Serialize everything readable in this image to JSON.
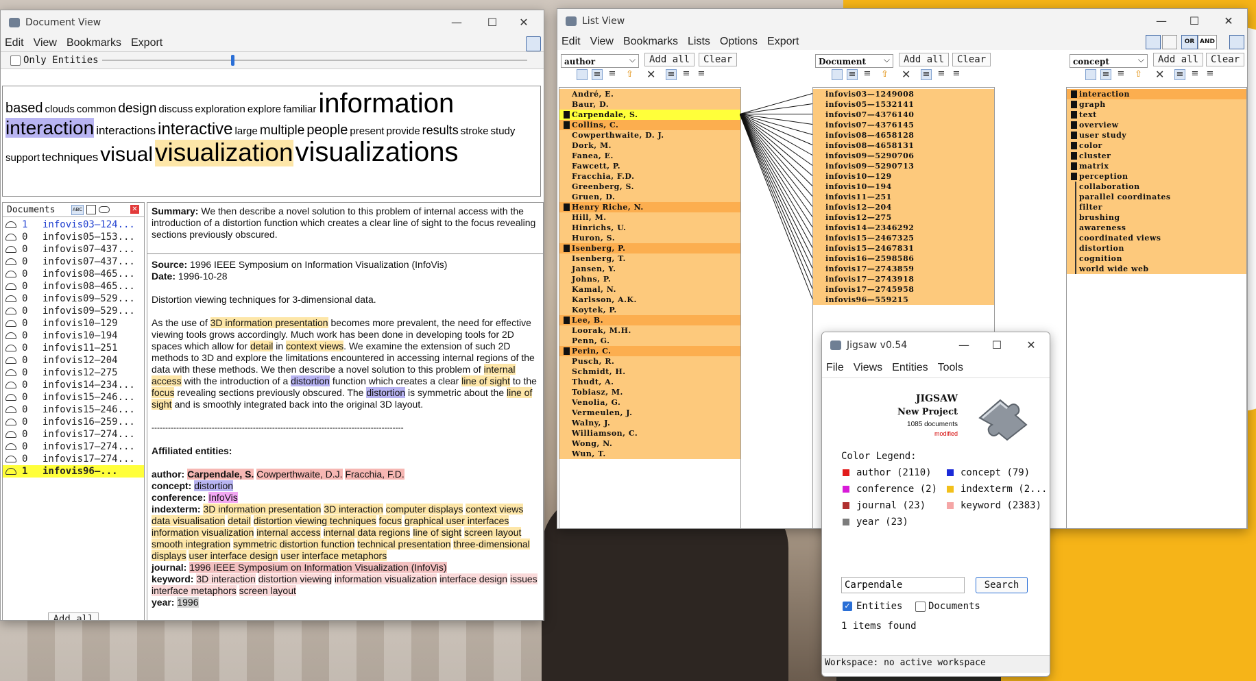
{
  "doc_view": {
    "title": "Document View",
    "menu": [
      "Edit",
      "View",
      "Bookmarks",
      "Export"
    ],
    "only_entities_label": "Only Entities",
    "cloud": [
      {
        "w": "based",
        "s": 20
      },
      {
        "w": "clouds",
        "s": 15
      },
      {
        "w": "common",
        "s": 15
      },
      {
        "w": "design",
        "s": 19
      },
      {
        "w": "discuss",
        "s": 15
      },
      {
        "w": "exploration",
        "s": 15
      },
      {
        "w": "explore",
        "s": 15
      },
      {
        "w": "familiar",
        "s": 15
      },
      {
        "w": "information",
        "s": 40
      },
      {
        "w": "interaction",
        "s": 28,
        "hl": "blue"
      },
      {
        "w": "interactions",
        "s": 17
      },
      {
        "w": "interactive",
        "s": 24
      },
      {
        "w": "large",
        "s": 15
      },
      {
        "w": "multiple",
        "s": 19
      },
      {
        "w": "people",
        "s": 20
      },
      {
        "w": "present",
        "s": 15
      },
      {
        "w": "provide",
        "s": 15
      },
      {
        "w": "results",
        "s": 18
      },
      {
        "w": "stroke",
        "s": 15
      },
      {
        "w": "study",
        "s": 15
      },
      {
        "w": "support",
        "s": 15
      },
      {
        "w": "techniques",
        "s": 17
      },
      {
        "w": "visual",
        "s": 30
      },
      {
        "w": "visualization",
        "s": 37,
        "hl": "yellow"
      },
      {
        "w": "visualizations",
        "s": 40
      }
    ],
    "documents_label": "Documents",
    "add_all": "Add all",
    "documents": [
      {
        "n": "1",
        "id": "infovis03—124...",
        "link": true
      },
      {
        "n": "0",
        "id": "infovis05—153..."
      },
      {
        "n": "0",
        "id": "infovis07—437..."
      },
      {
        "n": "0",
        "id": "infovis07—437..."
      },
      {
        "n": "0",
        "id": "infovis08—465..."
      },
      {
        "n": "0",
        "id": "infovis08—465..."
      },
      {
        "n": "0",
        "id": "infovis09—529..."
      },
      {
        "n": "0",
        "id": "infovis09—529..."
      },
      {
        "n": "0",
        "id": "infovis10—129"
      },
      {
        "n": "0",
        "id": "infovis10—194"
      },
      {
        "n": "0",
        "id": "infovis11—251"
      },
      {
        "n": "0",
        "id": "infovis12—204"
      },
      {
        "n": "0",
        "id": "infovis12—275"
      },
      {
        "n": "0",
        "id": "infovis14—234..."
      },
      {
        "n": "0",
        "id": "infovis15—246..."
      },
      {
        "n": "0",
        "id": "infovis15—246..."
      },
      {
        "n": "0",
        "id": "infovis16—259..."
      },
      {
        "n": "0",
        "id": "infovis17—274..."
      },
      {
        "n": "0",
        "id": "infovis17—274..."
      },
      {
        "n": "0",
        "id": "infovis17—274..."
      },
      {
        "n": "1",
        "id": "infovis96—...",
        "sel": true
      }
    ],
    "summary_label": "Summary:",
    "summary_text": "We then describe a novel solution to this problem of internal access with the introduction of a distortion function which creates a clear line of sight to the focus revealing sections previously obscured.",
    "source_label": "Source:",
    "source_text": "1996 IEEE Symposium on Information Visualization (InfoVis)",
    "date_label": "Date:",
    "date_text": "1996-10-28",
    "doc_title": "Distortion viewing techniques for 3-dimensional data.",
    "divider": "--------------------------------------------------------------------------------------------",
    "affiliated_label": "Affiliated entities:",
    "author_label": "author:",
    "authors": [
      "Carpendale, S.",
      "Cowperthwaite, D.J.",
      "Fracchia, F.D."
    ],
    "concept_label": "concept:",
    "concept": "distortion",
    "conference_label": "conference:",
    "conference": "InfoVis",
    "indexterm_label": "indexterm:",
    "indexterms": [
      "3D information presentation",
      "3D interaction",
      "computer displays",
      "context views",
      "data visualisation",
      "detail",
      "distortion viewing techniques",
      "focus",
      "graphical user interfaces",
      "information visualization",
      "internal access",
      "internal data regions",
      "line of sight",
      "screen layout",
      "smooth integration",
      "symmetric distortion function",
      "technical presentation",
      "three-dimensional displays",
      "user interface design",
      "user interface metaphors"
    ],
    "journal_label": "journal:",
    "journal": "1996 IEEE Symposium on Information Visualization (InfoVis)",
    "keyword_label": "keyword:",
    "keywords": [
      "3D interaction",
      "distortion viewing",
      "information visualization",
      "interface design",
      "issues",
      "interface metaphors",
      "screen layout"
    ],
    "year_label": "year:",
    "year": "1996"
  },
  "list_view": {
    "title": "List View",
    "menu": [
      "Edit",
      "View",
      "Bookmarks",
      "Lists",
      "Options",
      "Export"
    ],
    "or_label": "OR",
    "and_label": "AND",
    "add_all": "Add all",
    "clear": "Clear",
    "col1_type": "author",
    "col2_type": "Document",
    "col3_type": "concept",
    "authors": [
      {
        "t": "André, E.",
        "c": "o"
      },
      {
        "t": "Baur, D.",
        "c": "o"
      },
      {
        "t": "Carpendale, S.",
        "c": "ys",
        "mk": true
      },
      {
        "t": "Collins, C.",
        "c": "o2",
        "mk": true
      },
      {
        "t": "Cowperthwaite, D. J.",
        "c": "o"
      },
      {
        "t": "Dork, M.",
        "c": "o"
      },
      {
        "t": "Fanea, E.",
        "c": "o"
      },
      {
        "t": "Fawcett, P.",
        "c": "o"
      },
      {
        "t": "Fracchia, F.D.",
        "c": "o"
      },
      {
        "t": "Greenberg, S.",
        "c": "o"
      },
      {
        "t": "Gruen, D.",
        "c": "o"
      },
      {
        "t": "Henry Riche, N.",
        "c": "o2",
        "mk": true
      },
      {
        "t": "Hill, M.",
        "c": "o"
      },
      {
        "t": "Hinrichs, U.",
        "c": "o"
      },
      {
        "t": "Huron, S.",
        "c": "o"
      },
      {
        "t": "Isenberg, P.",
        "c": "o2",
        "mk": true
      },
      {
        "t": "Isenberg, T.",
        "c": "o"
      },
      {
        "t": "Jansen, Y.",
        "c": "o"
      },
      {
        "t": "Johns, P.",
        "c": "o"
      },
      {
        "t": "Kamal, N.",
        "c": "o"
      },
      {
        "t": "Karlsson, A.K.",
        "c": "o"
      },
      {
        "t": "Koytek, P.",
        "c": "o"
      },
      {
        "t": "Lee, B.",
        "c": "o2",
        "mk": true
      },
      {
        "t": "Loorak, M.H.",
        "c": "o"
      },
      {
        "t": "Penn, G.",
        "c": "o"
      },
      {
        "t": "Perin, C.",
        "c": "o2",
        "mk": true
      },
      {
        "t": "Pusch, R.",
        "c": "o"
      },
      {
        "t": "Schmidt, H.",
        "c": "o"
      },
      {
        "t": "Thudt, A.",
        "c": "o"
      },
      {
        "t": "Tobiasz, M.",
        "c": "o"
      },
      {
        "t": "Venolia, G.",
        "c": "o"
      },
      {
        "t": "Vermeulen, J.",
        "c": "o"
      },
      {
        "t": "Walny, J.",
        "c": "o"
      },
      {
        "t": "Williamson, C.",
        "c": "o"
      },
      {
        "t": "Wong, N.",
        "c": "o"
      },
      {
        "t": "Wun, T.",
        "c": "o"
      }
    ],
    "documents": [
      "infovis03—1249008",
      "infovis05—1532141",
      "infovis07—4376140",
      "infovis07—4376145",
      "infovis08—4658128",
      "infovis08—4658131",
      "infovis09—5290706",
      "infovis09—5290713",
      "infovis10—129",
      "infovis10—194",
      "infovis11—251",
      "infovis12—204",
      "infovis12—275",
      "infovis14—2346292",
      "infovis15—2467325",
      "infovis15—2467831",
      "infovis16—2598586",
      "infovis17—2743859",
      "infovis17—2743918",
      "infovis17—2745958",
      "infovis96—559215"
    ],
    "concepts": [
      {
        "t": "interaction",
        "c": "o2",
        "mk": true
      },
      {
        "t": "graph",
        "c": "o",
        "mk": true
      },
      {
        "t": "text",
        "c": "o",
        "mk": true
      },
      {
        "t": "overview",
        "c": "o",
        "mk": true
      },
      {
        "t": "user study",
        "c": "o",
        "mk": true
      },
      {
        "t": "color",
        "c": "o",
        "mk": true
      },
      {
        "t": "cluster",
        "c": "o",
        "mk": true
      },
      {
        "t": "matrix",
        "c": "o",
        "mk": true
      },
      {
        "t": "perception",
        "c": "o",
        "mk": true
      },
      {
        "t": "collaboration",
        "c": "o",
        "bar": true
      },
      {
        "t": "parallel coordinates",
        "c": "o",
        "bar": true
      },
      {
        "t": "filter",
        "c": "o",
        "bar": true
      },
      {
        "t": "brushing",
        "c": "o",
        "bar": true
      },
      {
        "t": "awareness",
        "c": "o",
        "bar": true
      },
      {
        "t": "coordinated views",
        "c": "o",
        "bar": true
      },
      {
        "t": "distortion",
        "c": "o",
        "bar": true
      },
      {
        "t": "cognition",
        "c": "o",
        "bar": true
      },
      {
        "t": "world wide web",
        "c": "o",
        "bar": true
      }
    ]
  },
  "jigsaw": {
    "title": "Jigsaw v0.54",
    "menu": [
      "File",
      "Views",
      "Entities",
      "Tools"
    ],
    "app_name": "JIGSAW",
    "project": "New Project",
    "doc_count": "1085 documents",
    "modified": "modified",
    "legend_title": "Color Legend:",
    "legend": [
      {
        "label": "author (2110)",
        "color": "#e21b1b"
      },
      {
        "label": "concept (79)",
        "color": "#1b2ad8"
      },
      {
        "label": "conference (2)",
        "color": "#d81bd8"
      },
      {
        "label": "indexterm (2...",
        "color": "#f2c01b"
      },
      {
        "label": "journal (23)",
        "color": "#b0302f"
      },
      {
        "label": "keyword (2383)",
        "color": "#f5a6a6"
      },
      {
        "label": "year (23)",
        "color": "#7c7c7c"
      }
    ],
    "search_value": "Carpendale",
    "search_button": "Search",
    "entities_label": "Entities",
    "documents_label": "Documents",
    "found": "1 items found",
    "workspace": "Workspace: no active workspace"
  }
}
